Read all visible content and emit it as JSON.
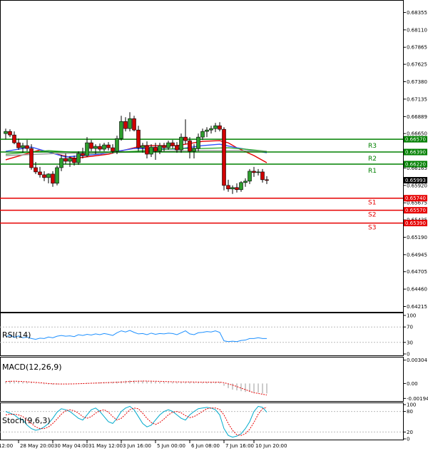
{
  "chart_data": {
    "type": "candlestick",
    "main": {
      "price_ticks": [
        "0.68355",
        "0.68110",
        "0.67865",
        "0.67625",
        "0.67380",
        "0.67135",
        "0.66889",
        "0.66650",
        "0.66405",
        "0.66165",
        "0.65920",
        "0.65675",
        "0.65435",
        "0.65190",
        "0.64945",
        "0.64705",
        "0.64460",
        "0.64215"
      ],
      "ylim": [
        0.6419,
        0.6845
      ],
      "current_price": "0.65993",
      "levels": [
        {
          "name": "R3",
          "value": 0.6657,
          "label": "0.66570",
          "color": "#008000"
        },
        {
          "name": "R2",
          "value": 0.6639,
          "label": "0.66390",
          "color": "#008000"
        },
        {
          "name": "R1",
          "value": 0.6622,
          "label": "0.66220",
          "color": "#008000"
        },
        {
          "name": "S1",
          "value": 0.6574,
          "label": "0.65740",
          "color": "#e60000"
        },
        {
          "name": "S2",
          "value": 0.6557,
          "label": "0.65570",
          "color": "#e60000"
        },
        {
          "name": "S3",
          "value": 0.6539,
          "label": "0.65390",
          "color": "#e60000"
        }
      ],
      "candles": [
        [
          0.6665,
          0.6672,
          0.6657,
          0.6668
        ],
        [
          0.6668,
          0.6671,
          0.666,
          0.6663
        ],
        [
          0.6663,
          0.6668,
          0.665,
          0.6652
        ],
        [
          0.6652,
          0.6658,
          0.6642,
          0.6645
        ],
        [
          0.6645,
          0.6652,
          0.6638,
          0.6648
        ],
        [
          0.6648,
          0.6656,
          0.664,
          0.6644
        ],
        [
          0.6644,
          0.665,
          0.6614,
          0.6617
        ],
        [
          0.6617,
          0.6625,
          0.6608,
          0.6611
        ],
        [
          0.6611,
          0.6618,
          0.6603,
          0.6607
        ],
        [
          0.6607,
          0.6612,
          0.6598,
          0.6603
        ],
        [
          0.6603,
          0.6609,
          0.6595,
          0.6608
        ],
        [
          0.6608,
          0.6612,
          0.659,
          0.6595
        ],
        [
          0.6595,
          0.662,
          0.6592,
          0.6617
        ],
        [
          0.6617,
          0.6635,
          0.6612,
          0.663
        ],
        [
          0.663,
          0.6637,
          0.6622,
          0.6626
        ],
        [
          0.6626,
          0.6633,
          0.6618,
          0.663
        ],
        [
          0.663,
          0.6634,
          0.662,
          0.6624
        ],
        [
          0.6624,
          0.664,
          0.6621,
          0.6637
        ],
        [
          0.6637,
          0.6645,
          0.663,
          0.6634
        ],
        [
          0.6634,
          0.666,
          0.6632,
          0.6652
        ],
        [
          0.6652,
          0.6656,
          0.664,
          0.6644
        ],
        [
          0.6644,
          0.665,
          0.6636,
          0.6647
        ],
        [
          0.6647,
          0.6651,
          0.664,
          0.6643
        ],
        [
          0.6643,
          0.6652,
          0.664,
          0.6649
        ],
        [
          0.6649,
          0.6653,
          0.6641,
          0.6645
        ],
        [
          0.6645,
          0.665,
          0.6637,
          0.664
        ],
        [
          0.664,
          0.6662,
          0.6636,
          0.6658
        ],
        [
          0.6658,
          0.669,
          0.6655,
          0.6682
        ],
        [
          0.6682,
          0.6688,
          0.6668,
          0.6672
        ],
        [
          0.6672,
          0.6695,
          0.6668,
          0.6686
        ],
        [
          0.6686,
          0.669,
          0.6668,
          0.667
        ],
        [
          0.667,
          0.6676,
          0.664,
          0.6645
        ],
        [
          0.6645,
          0.6652,
          0.6638,
          0.6648
        ],
        [
          0.6648,
          0.6654,
          0.663,
          0.6636
        ],
        [
          0.6636,
          0.665,
          0.6632,
          0.6646
        ],
        [
          0.6646,
          0.6652,
          0.6628,
          0.664
        ],
        [
          0.664,
          0.6652,
          0.6636,
          0.6648
        ],
        [
          0.6648,
          0.6652,
          0.664,
          0.6645
        ],
        [
          0.6645,
          0.6655,
          0.6642,
          0.6652
        ],
        [
          0.6652,
          0.6656,
          0.6644,
          0.6648
        ],
        [
          0.6648,
          0.6653,
          0.6638,
          0.6642
        ],
        [
          0.6642,
          0.6665,
          0.6638,
          0.666
        ],
        [
          0.666,
          0.6685,
          0.665,
          0.6655
        ],
        [
          0.6655,
          0.666,
          0.663,
          0.664
        ],
        [
          0.664,
          0.665,
          0.663,
          0.6644
        ],
        [
          0.6644,
          0.6665,
          0.664,
          0.666
        ],
        [
          0.666,
          0.6672,
          0.6656,
          0.6668
        ],
        [
          0.6668,
          0.6674,
          0.666,
          0.667
        ],
        [
          0.667,
          0.6676,
          0.6665,
          0.6672
        ],
        [
          0.6672,
          0.668,
          0.6667,
          0.6676
        ],
        [
          0.6676,
          0.6681,
          0.6668,
          0.6671
        ],
        [
          0.6671,
          0.6674,
          0.6585,
          0.6592
        ],
        [
          0.6592,
          0.66,
          0.6583,
          0.6587
        ],
        [
          0.6587,
          0.6592,
          0.658,
          0.6589
        ],
        [
          0.6589,
          0.6595,
          0.6582,
          0.6586
        ],
        [
          0.6586,
          0.6598,
          0.6583,
          0.6596
        ],
        [
          0.6596,
          0.6602,
          0.659,
          0.6598
        ],
        [
          0.6598,
          0.6615,
          0.6594,
          0.6612
        ],
        [
          0.6612,
          0.6618,
          0.6604,
          0.661
        ],
        [
          0.661,
          0.6615,
          0.6606,
          0.6611
        ],
        [
          0.6611,
          0.6615,
          0.6596,
          0.66
        ],
        [
          0.66,
          0.6605,
          0.6594,
          0.6599
        ]
      ],
      "ma": [
        {
          "color": "#e60000",
          "points": [
            [
              0,
              0.6628
            ],
            [
              8,
              0.6642
            ],
            [
              16,
              0.663
            ],
            [
              24,
              0.6636
            ],
            [
              32,
              0.6648
            ],
            [
              40,
              0.6648
            ],
            [
              46,
              0.6654
            ],
            [
              50,
              0.6655
            ],
            [
              52,
              0.6652
            ],
            [
              54,
              0.6645
            ],
            [
              58,
              0.6634
            ],
            [
              61,
              0.6624
            ]
          ]
        },
        {
          "color": "#3355ff",
          "points": [
            [
              0,
              0.664
            ],
            [
              6,
              0.6646
            ],
            [
              14,
              0.6632
            ],
            [
              22,
              0.6636
            ],
            [
              30,
              0.6644
            ],
            [
              40,
              0.6643
            ],
            [
              46,
              0.6648
            ],
            [
              50,
              0.665
            ],
            [
              54,
              0.6645
            ],
            [
              58,
              0.6641
            ],
            [
              61,
              0.6638
            ]
          ]
        },
        {
          "color": "#33aa33",
          "points": [
            [
              0,
              0.6636
            ],
            [
              10,
              0.6641
            ],
            [
              20,
              0.6637
            ],
            [
              30,
              0.664
            ],
            [
              40,
              0.6644
            ],
            [
              46,
              0.6644
            ],
            [
              52,
              0.6645
            ],
            [
              56,
              0.6643
            ],
            [
              61,
              0.664
            ]
          ]
        },
        {
          "color": "#999999",
          "points": [
            [
              0,
              0.6634
            ],
            [
              12,
              0.6637
            ],
            [
              24,
              0.6638
            ],
            [
              36,
              0.664
            ],
            [
              46,
              0.6641
            ],
            [
              54,
              0.6641
            ],
            [
              61,
              0.664
            ]
          ]
        }
      ]
    },
    "rsi": {
      "label": "RSI(14)",
      "ticks": [
        "100",
        "70",
        "30",
        "0"
      ],
      "tick_values": [
        100,
        70,
        30,
        0
      ],
      "ylim": [
        0,
        100
      ],
      "values": [
        45,
        48,
        43,
        47,
        42,
        44,
        40,
        38,
        41,
        40,
        44,
        42,
        46,
        48,
        46,
        47,
        45,
        50,
        48,
        51,
        49,
        52,
        50,
        53,
        51,
        48,
        55,
        60,
        57,
        61,
        56,
        52,
        53,
        50,
        54,
        51,
        53,
        52,
        54,
        53,
        50,
        55,
        60,
        52,
        50,
        55,
        56,
        58,
        57,
        60,
        56,
        34,
        32,
        33,
        32,
        35,
        36,
        40,
        40,
        42,
        40,
        40
      ]
    },
    "macd": {
      "label": "MACD(12,26,9)",
      "ticks": [
        "0.00304",
        "0.00",
        "-0.001945"
      ],
      "tick_values": [
        0.00304,
        0.0,
        -0.001945
      ],
      "ylim": [
        -0.0021,
        0.0031
      ],
      "histogram": [
        0.0003,
        0.00035,
        0.0003,
        0.00025,
        0.0002,
        0.00018,
        0.0001,
        5e-05,
        -5e-05,
        -0.0001,
        -0.00012,
        -0.00015,
        -0.00012,
        -8e-05,
        -5e-05,
        -3e-05,
        -1e-05,
        2e-05,
        4e-05,
        8e-05,
        0.0001,
        0.00012,
        0.00015,
        0.00018,
        0.0002,
        0.0002,
        0.00025,
        0.0003,
        0.00035,
        0.0004,
        0.0004,
        0.00038,
        0.00035,
        0.0003,
        0.00028,
        0.00025,
        0.00022,
        0.0002,
        0.00018,
        0.00017,
        0.00015,
        0.00015,
        0.00018,
        0.0002,
        0.00015,
        0.00012,
        0.00012,
        0.00015,
        0.00018,
        0.0002,
        0.00018,
        -0.0003,
        -0.0006,
        -0.0008,
        -0.0009,
        -0.001,
        -0.0011,
        -0.0011,
        -0.0012,
        -0.0012,
        -0.0013,
        -0.0013
      ],
      "signal": [
        0.00025,
        0.00028,
        0.0003,
        0.00028,
        0.00025,
        0.00022,
        0.00018,
        0.00014,
        0.0001,
        5e-05,
        0.0,
        -4e-05,
        -6e-05,
        -7e-05,
        -7e-05,
        -6e-05,
        -5e-05,
        -3e-05,
        -1e-05,
        1e-05,
        3e-05,
        5e-05,
        7e-05,
        0.0001,
        0.00012,
        0.00014,
        0.00016,
        0.00019,
        0.00022,
        0.00025,
        0.00028,
        0.0003,
        0.00031,
        0.00031,
        0.0003,
        0.00029,
        0.00028,
        0.00026,
        0.00024,
        0.00022,
        0.00021,
        0.0002,
        0.0002,
        0.0002,
        0.00019,
        0.00018,
        0.00017,
        0.00017,
        0.00017,
        0.00018,
        0.00018,
        0.0001,
        -5e-05,
        -0.0002,
        -0.0004,
        -0.0006,
        -0.0008,
        -0.001,
        -0.0012,
        -0.0013,
        -0.0014,
        -0.0015
      ]
    },
    "stoch": {
      "label": "Stoch(9,6,3)",
      "ticks": [
        "100",
        "80",
        "20",
        "0"
      ],
      "tick_values": [
        100,
        80,
        20,
        0
      ],
      "ylim": [
        0,
        100
      ],
      "k": [
        80,
        75,
        70,
        60,
        55,
        40,
        30,
        25,
        28,
        35,
        45,
        60,
        78,
        88,
        85,
        80,
        70,
        60,
        55,
        70,
        85,
        90,
        80,
        65,
        50,
        45,
        60,
        80,
        90,
        95,
        85,
        65,
        45,
        35,
        40,
        55,
        70,
        80,
        85,
        80,
        70,
        60,
        55,
        70,
        80,
        88,
        90,
        92,
        90,
        85,
        70,
        30,
        10,
        5,
        8,
        15,
        30,
        50,
        80,
        95,
        92,
        78
      ],
      "d": [
        70,
        72,
        72,
        70,
        65,
        55,
        45,
        35,
        30,
        30,
        35,
        45,
        58,
        72,
        82,
        85,
        82,
        75,
        65,
        60,
        65,
        75,
        82,
        85,
        78,
        65,
        55,
        60,
        72,
        85,
        90,
        88,
        75,
        60,
        48,
        42,
        48,
        58,
        70,
        78,
        80,
        76,
        68,
        62,
        65,
        72,
        80,
        88,
        90,
        90,
        86,
        70,
        45,
        25,
        12,
        10,
        15,
        28,
        48,
        72,
        88,
        92
      ]
    },
    "x_ticks": [
      {
        "i": -2,
        "label": "12:00"
      },
      {
        "i": 3,
        "label": "28 May 20:00"
      },
      {
        "i": 11,
        "label": "30 May 04:00"
      },
      {
        "i": 19,
        "label": "31 May 12:00"
      },
      {
        "i": 27,
        "label": "3 Jun 16:00"
      },
      {
        "i": 35,
        "label": "5 Jun 00:00"
      },
      {
        "i": 43,
        "label": "6 Jun 08:00"
      },
      {
        "i": 51,
        "label": "7 Jun 16:00"
      },
      {
        "i": 58,
        "label": "10 Jun 20:00"
      }
    ]
  }
}
